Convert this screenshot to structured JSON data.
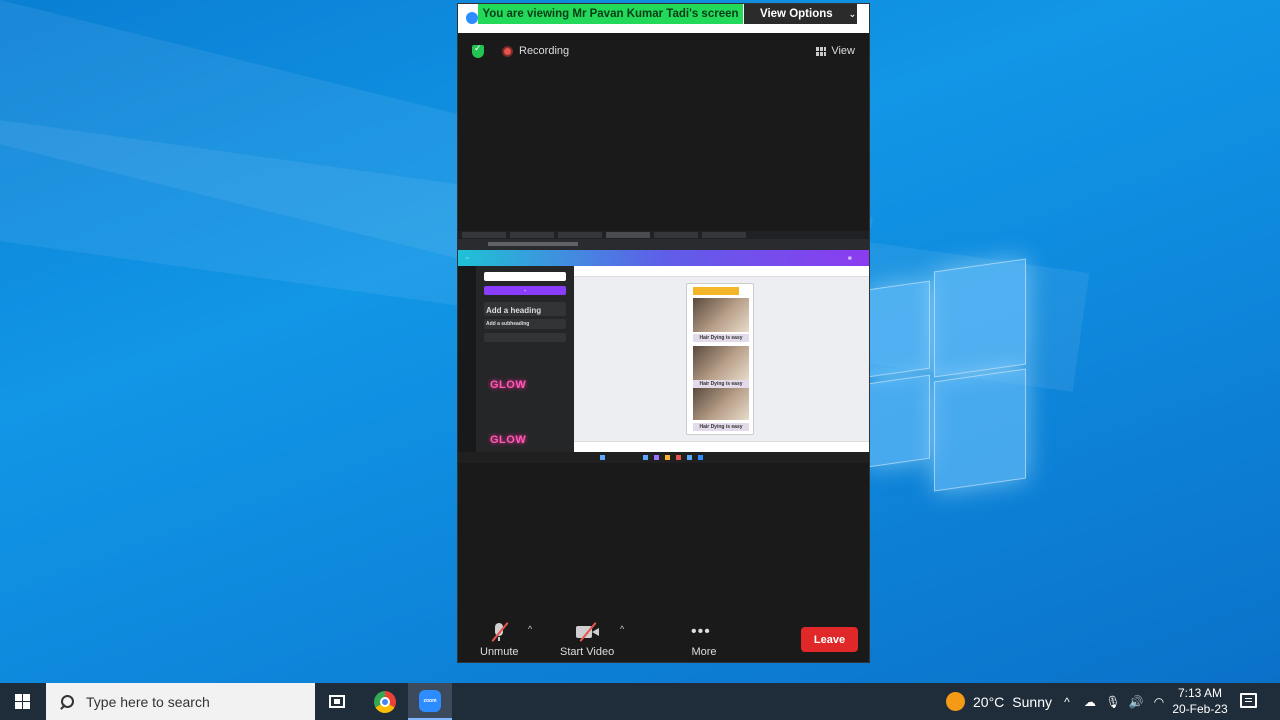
{
  "zoom": {
    "banner_text": "You are viewing Mr Pavan Kumar Tadi's screen",
    "view_options_label": "View Options",
    "recording_label": "Recording",
    "view_label": "View",
    "controls": {
      "unmute_label": "Unmute",
      "start_video_label": "Start Video",
      "more_label": "More",
      "leave_label": "Leave"
    }
  },
  "shared_screen": {
    "panel": {
      "add_heading": "Add a heading",
      "add_subheading": "Add a subheading",
      "glow_text": "GLOW"
    },
    "design_caption": "Hair Dying is easy"
  },
  "taskbar": {
    "search_placeholder": "Type here to search",
    "weather": {
      "temperature": "20°C",
      "condition": "Sunny"
    },
    "clock": {
      "time": "7:13 AM",
      "date": "20-Feb-23"
    }
  },
  "colors": {
    "banner_green": "#23d959",
    "leave_red": "#e02828",
    "desktop_blue": "#1296e6"
  }
}
